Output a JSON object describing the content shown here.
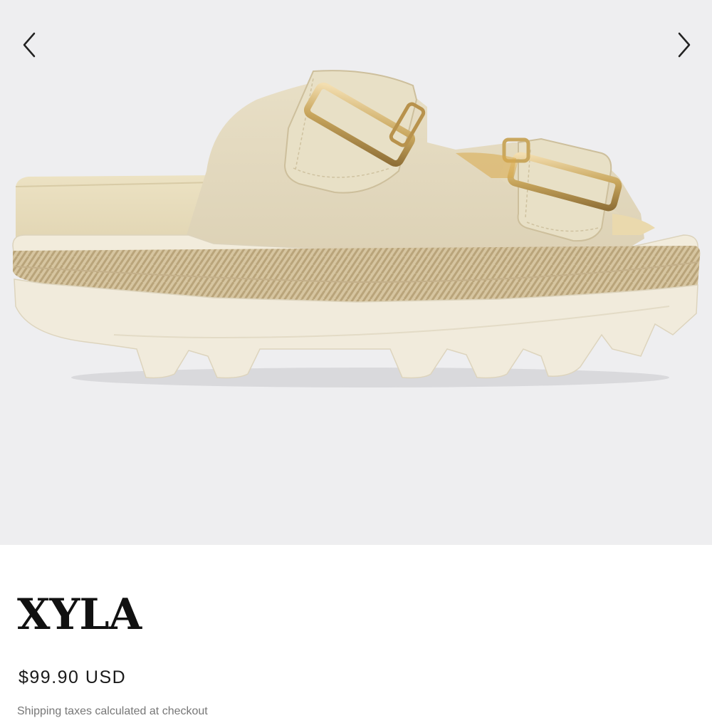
{
  "gallery": {
    "prev_icon": "chevron-left-icon",
    "next_icon": "chevron-right-icon",
    "background": "#eeeef0"
  },
  "product": {
    "name": "XYLA",
    "price": "$99.90 USD",
    "shipping_note": "Shipping taxes calculated at checkout"
  },
  "colors": {
    "upper": "#e5dcc3",
    "sole": "#efe9d8",
    "jute": "#d1bf98",
    "buckle": "#c9a75e"
  }
}
